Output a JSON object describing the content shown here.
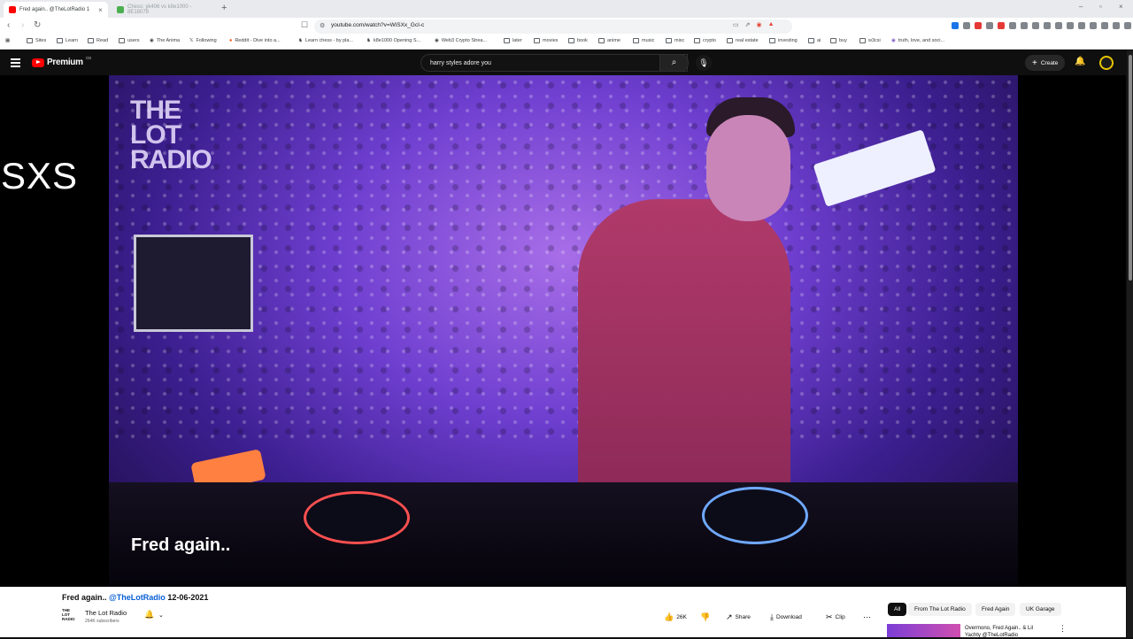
{
  "browser": {
    "tabs": [
      {
        "label": "Fred again.. @TheLotRadio 1",
        "active": true
      },
      {
        "label": "Chess: yk406 vs k8e1000 - 8E18078",
        "active": false
      }
    ],
    "new_tab": "+",
    "url": "youtube.com/watch?v=WiSXx_GcI-c",
    "bookmarks": [
      "Sites",
      "Learn",
      "Read",
      "users",
      "The Anima",
      "Following",
      "Reddit - Dive into a...",
      "Learn chess - by pla...",
      "k8e1000 Opening S...",
      "Web3 Crypto Strea...",
      "later",
      "movies",
      "book",
      "anime",
      "music",
      "misc",
      "crypto",
      "real estate",
      "investing",
      "ai",
      "buy",
      "w3csi",
      "truth, love, and soci..."
    ]
  },
  "youtube": {
    "logo_text": "Premium",
    "logo_badge": "GB",
    "search_query": "harry styles adore you",
    "create_label": "Create"
  },
  "player": {
    "side_text": "SXS",
    "watermark": "THE LOT RADIO",
    "caption": "Fred again.."
  },
  "video_info": {
    "title_pre": "Fred again..",
    "title_handle": "@TheLotRadio",
    "title_date": "12-06-2021",
    "channel_logo": "THE LOT RADIO",
    "channel_name": "The Lot Radio",
    "subscribers": "264K subscribers",
    "likes": "26K",
    "share": "Share",
    "download": "Download",
    "clip": "Clip"
  },
  "recommendations": {
    "chips": [
      "All",
      "From The Lot Radio",
      "Fred Again",
      "UK Garage"
    ],
    "first_title": "Overmono, Fred Again.. & Lil Yachty @TheLotRadio"
  },
  "colors": {
    "yt_red": "#ff0000",
    "link_blue": "#065fd4",
    "stage_purple": "#6f3fd0"
  }
}
